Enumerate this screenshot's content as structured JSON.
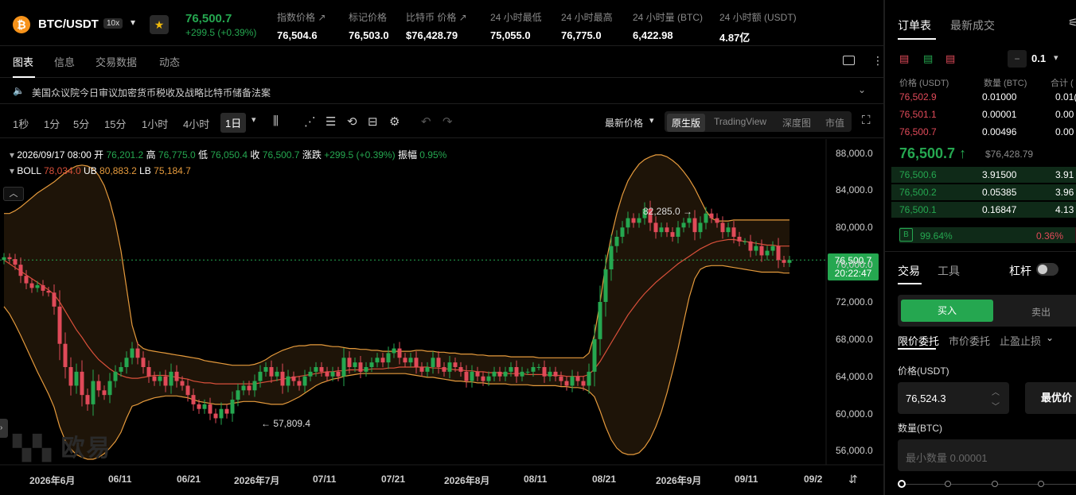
{
  "header": {
    "coin_symbol": "₿",
    "pair": "BTC/USDT",
    "leverage": "10x",
    "last_price": "76,500.7",
    "change": "+299.5 (+0.39%)",
    "stats": [
      {
        "label": "指数价格 ↗",
        "value": "76,504.6"
      },
      {
        "label": "标记价格",
        "value": "76,503.0"
      },
      {
        "label": "比特币 价格 ↗",
        "value": "$76,428.79"
      },
      {
        "label": "24 小时最低",
        "value": "75,055.0"
      },
      {
        "label": "24 小时最高",
        "value": "76,775.0"
      },
      {
        "label": "24 小时量 (BTC)",
        "value": "6,422.98"
      },
      {
        "label": "24 小时额 (USDT)",
        "value": "4.87亿"
      }
    ]
  },
  "tabs": [
    "图表",
    "信息",
    "交易数据",
    "动态"
  ],
  "news": "美国众议院今日审议加密货币税收及战略比特币储备法案",
  "timeframes": [
    "1秒",
    "1分",
    "5分",
    "15分",
    "1小时",
    "4小时",
    "1日"
  ],
  "price_type": "最新价格",
  "chart_types": [
    "原生版",
    "TradingView",
    "深度图",
    "市值"
  ],
  "ohlc": {
    "date": "2026/09/17 08:00",
    "open_label": "开",
    "open": "76,201.2",
    "high_label": "高",
    "high": "76,775.0",
    "low_label": "低",
    "low": "76,050.4",
    "close_label": "收",
    "close": "76,500.7",
    "change_label": "涨跌",
    "change": "+299.5 (+0.39%)",
    "amp_label": "振幅",
    "amp": "0.95%"
  },
  "boll": {
    "label": "BOLL",
    "mid": "78,034.0",
    "ub_label": "UB",
    "ub": "80,883.2",
    "lb_label": "LB",
    "lb": "75,184.7"
  },
  "chart_data": {
    "type": "candlestick",
    "y_ticks": [
      "88,000.0",
      "84,000.0",
      "80,000.0",
      "76,000.0",
      "72,000.0",
      "68,000.0",
      "64,000.0",
      "60,000.0",
      "56,000.0"
    ],
    "x_ticks": [
      "2026年6月",
      "06/11",
      "06/21",
      "2026年7月",
      "07/11",
      "07/21",
      "2026年8月",
      "08/11",
      "08/21",
      "2026年9月",
      "09/11",
      "09/2"
    ],
    "current_price": "76,500.7",
    "countdown": "20:22:47",
    "high_annotation": "82,285.0 →",
    "low_annotation": "← 57,809.4",
    "ylim": [
      54500,
      89500
    ],
    "closes": [
      76800,
      76600,
      76000,
      74800,
      74000,
      73500,
      73800,
      73200,
      73000,
      71500,
      67500,
      65000,
      63000,
      64500,
      62000,
      61000,
      63500,
      62500,
      62000,
      63500,
      64500,
      65000,
      66000,
      67000,
      66000,
      65000,
      64000,
      63500,
      64000,
      63000,
      64500,
      63500,
      63000,
      62000,
      61000,
      60500,
      61000,
      60000,
      59500,
      60500,
      60000,
      61500,
      62500,
      63000,
      62500,
      63500,
      64500,
      65000,
      64000,
      64500,
      63000,
      64000,
      63500,
      63000,
      64000,
      64500,
      65000,
      64500,
      64000,
      64500,
      64000,
      66000,
      65000,
      65500,
      64500,
      65000,
      65500,
      66000,
      65500,
      66500,
      67000,
      66000,
      65500,
      66000,
      65000,
      64500,
      65000,
      66000,
      65000,
      64500,
      65500,
      65000,
      64500,
      63500,
      64500,
      64000,
      63500,
      64000,
      64500,
      64000,
      64500,
      65000,
      64000,
      64500,
      64500,
      65000,
      65000,
      64000,
      64500,
      64000,
      63500,
      63000,
      64000,
      63500,
      63000,
      64500,
      68000,
      72000,
      75500,
      78000,
      79000,
      80000,
      81000,
      80500,
      81000,
      82000,
      80500,
      79500,
      80000,
      79500,
      79000,
      80000,
      80500,
      81000,
      79500,
      80500,
      81500,
      81000,
      80500,
      79500,
      80000,
      79000,
      78500,
      78500,
      77500,
      78000,
      77000,
      77500,
      78000,
      76500,
      76200,
      76500
    ],
    "mid": [
      76500,
      76100,
      75700,
      75300,
      74900,
      74500,
      74100,
      73700,
      73300,
      72800,
      72000,
      71000,
      70000,
      69000,
      68200,
      67300,
      66500,
      65800,
      65300,
      64800,
      64400,
      64100,
      63900,
      63800,
      63800,
      63900,
      64000,
      64100,
      64100,
      64100,
      64000,
      63900,
      63800,
      63700,
      63500,
      63400,
      63300,
      63300,
      63200,
      63200,
      63200,
      63200,
      63200,
      63200,
      63200,
      63200,
      63300,
      63400,
      63500,
      63600,
      63700,
      63800,
      63900,
      64000,
      64100,
      64200,
      64300,
      64400,
      64500,
      64500,
      64600,
      64600,
      64700,
      64700,
      64700,
      64700,
      64800,
      64800,
      64800,
      64900,
      64900,
      65000,
      65000,
      65000,
      65000,
      65000,
      65000,
      64900,
      64900,
      64800,
      64800,
      64700,
      64700,
      64600,
      64600,
      64500,
      64500,
      64400,
      64400,
      64400,
      64300,
      64300,
      64300,
      64300,
      64200,
      64200,
      64200,
      64200,
      64100,
      64100,
      64100,
      64000,
      64000,
      64000,
      64000,
      64200,
      64800,
      65600,
      66600,
      67600,
      68600,
      69600,
      70600,
      71400,
      72200,
      72900,
      73500,
      74100,
      74600,
      75100,
      75600,
      76100,
      76500,
      76900,
      77300,
      77700,
      78000,
      78300,
      78500,
      78600,
      78700,
      78700,
      78600,
      78500,
      78400,
      78300,
      78200,
      78100,
      78100,
      78000,
      78000,
      78000
    ],
    "upper": [
      81500,
      81500,
      81800,
      82200,
      82700,
      83200,
      83700,
      84100,
      84500,
      84900,
      85400,
      85900,
      86300,
      86600,
      86700,
      86600,
      86300,
      85600,
      84500,
      82800,
      80500,
      77500,
      73500,
      69500,
      67500,
      67000,
      66800,
      66700,
      66600,
      66500,
      66400,
      66300,
      66200,
      66100,
      66000,
      65900,
      65700,
      65600,
      65500,
      65400,
      65300,
      65200,
      65200,
      65200,
      65200,
      65300,
      65500,
      65800,
      66200,
      66500,
      66800,
      67000,
      67200,
      67300,
      67300,
      67400,
      67400,
      67400,
      67300,
      67200,
      67200,
      67100,
      67000,
      67000,
      66900,
      66900,
      66800,
      66800,
      66700,
      66700,
      66700,
      66700,
      66700,
      66700,
      66800,
      66800,
      66700,
      66700,
      66600,
      66600,
      66500,
      66500,
      66400,
      66400,
      66400,
      66300,
      66300,
      66200,
      66200,
      66200,
      66200,
      66100,
      66100,
      66100,
      66100,
      66100,
      66000,
      66000,
      66000,
      66000,
      66000,
      66000,
      66000,
      66000,
      66000,
      66500,
      68500,
      72000,
      76000,
      79000,
      81500,
      83500,
      85000,
      86000,
      86800,
      87300,
      87600,
      87800,
      87800,
      87600,
      87200,
      86700,
      86000,
      85200,
      84200,
      83000,
      81800,
      81000,
      80700,
      80700,
      80700,
      80800,
      80800,
      80800,
      80800,
      80800,
      80800,
      80800,
      80800,
      80800,
      80800,
      80800
    ],
    "lower": [
      71500,
      70700,
      69600,
      68400,
      67100,
      65800,
      64500,
      63300,
      62100,
      60700,
      58600,
      57100,
      56200,
      55600,
      55300,
      55100,
      55100,
      55300,
      55700,
      56300,
      57000,
      58000,
      59500,
      60800,
      61000,
      61300,
      61500,
      61700,
      61800,
      61900,
      61900,
      61900,
      61800,
      61700,
      61500,
      61300,
      61200,
      61100,
      61000,
      61000,
      61000,
      61100,
      61200,
      61300,
      61300,
      61300,
      61200,
      61100,
      61000,
      61000,
      61000,
      61200,
      61500,
      61800,
      62200,
      62600,
      63000,
      63300,
      63500,
      63700,
      63800,
      64000,
      64100,
      64200,
      64300,
      64300,
      64300,
      64300,
      64300,
      64300,
      64300,
      64300,
      64300,
      64200,
      64100,
      64000,
      63900,
      63900,
      63800,
      63700,
      63600,
      63500,
      63500,
      63400,
      63400,
      63300,
      63300,
      63200,
      63200,
      63200,
      63200,
      63100,
      63100,
      63100,
      63100,
      63000,
      63000,
      63000,
      63000,
      63000,
      62900,
      62900,
      62800,
      62800,
      62700,
      62400,
      61800,
      60300,
      58600,
      57200,
      56300,
      55800,
      55600,
      55600,
      55800,
      56400,
      57300,
      58600,
      60200,
      62200,
      64500,
      67000,
      69800,
      72500,
      74500,
      75500,
      75800,
      75900,
      75900,
      75900,
      75800,
      75700,
      75600,
      75500,
      75400,
      75300,
      75200,
      75200,
      75200,
      75200,
      75100,
      75100
    ]
  },
  "orderbook": {
    "title": "订单表",
    "trades_tab": "最新成交",
    "tick": "0.1",
    "headers": [
      "价格 (USDT)",
      "数量 (BTC)",
      "合计 ("
    ],
    "asks": [
      {
        "price": "76,502.9",
        "qty": "0.01000",
        "total": "0.01("
      },
      {
        "price": "76,501.1",
        "qty": "0.00001",
        "total": "0.00"
      },
      {
        "price": "76,500.7",
        "qty": "0.00496",
        "total": "0.00"
      }
    ],
    "mid_price": "76,500.7 ↑",
    "mid_usd": "$76,428.79",
    "bids": [
      {
        "price": "76,500.6",
        "qty": "3.91500",
        "total": "3.91"
      },
      {
        "price": "76,500.2",
        "qty": "0.05385",
        "total": "3.96"
      },
      {
        "price": "76,500.1",
        "qty": "0.16847",
        "total": "4.13"
      }
    ],
    "buy_label": "B",
    "buy_pct": "99.64%",
    "sell_pct": "0.36%",
    "buy_ratio": 0.9964
  },
  "trade": {
    "tab_trade": "交易",
    "tab_tools": "工具",
    "leverage_label": "杠杆",
    "buy": "买入",
    "sell": "卖出",
    "order_types": [
      "限价委托",
      "市价委托",
      "止盈止损"
    ],
    "price_label": "价格(USDT)",
    "price_value": "76,524.3",
    "best_price": "最优价",
    "qty_label": "数量(BTC)",
    "qty_placeholder": "最小数量 0.00001"
  },
  "watermark": "欧易",
  "colors": {
    "up": "#25a750",
    "down": "#e04a59",
    "boll_band": "#e59a3c",
    "boll_mid": "#d9503a"
  }
}
